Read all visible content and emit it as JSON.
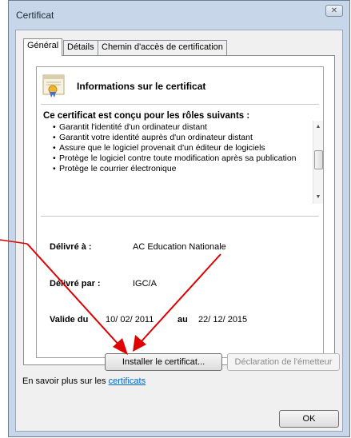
{
  "window": {
    "title": "Certificat",
    "close_icon": "close-icon"
  },
  "tabs": [
    {
      "label": "Général",
      "active": true
    },
    {
      "label": "Détails",
      "active": false
    },
    {
      "label": "Chemin d'accès de certification",
      "active": false
    }
  ],
  "cert": {
    "icon": "certificate-icon",
    "heading": "Informations sur le certificat",
    "purpose_heading": "Ce certificat est conçu pour les rôles suivants :",
    "purposes": [
      "Garantit l'identité d'un ordinateur distant",
      "Garantit votre identité auprès d'un ordinateur distant",
      "Assure que le logiciel provenait d'un éditeur de logiciels",
      "Protège le logiciel contre toute modification après sa publication",
      "Protège le courrier électronique"
    ],
    "issued_to_label": "Délivré à :",
    "issued_to_value": "AC Education Nationale",
    "issued_by_label": "Délivré par :",
    "issued_by_value": "IGC/A",
    "valid_from_label": "Valide du",
    "valid_from_value": "10/ 02/ 2011",
    "valid_to_label": "au",
    "valid_to_value": "22/ 12/ 2015"
  },
  "buttons": {
    "install": "Installer le certificat...",
    "issuer_statement": "Déclaration de l'émetteur",
    "ok": "OK"
  },
  "footer": {
    "text": "En savoir plus sur les",
    "link": "certificats"
  },
  "annotation": {
    "arrow_color": "#e00000"
  }
}
